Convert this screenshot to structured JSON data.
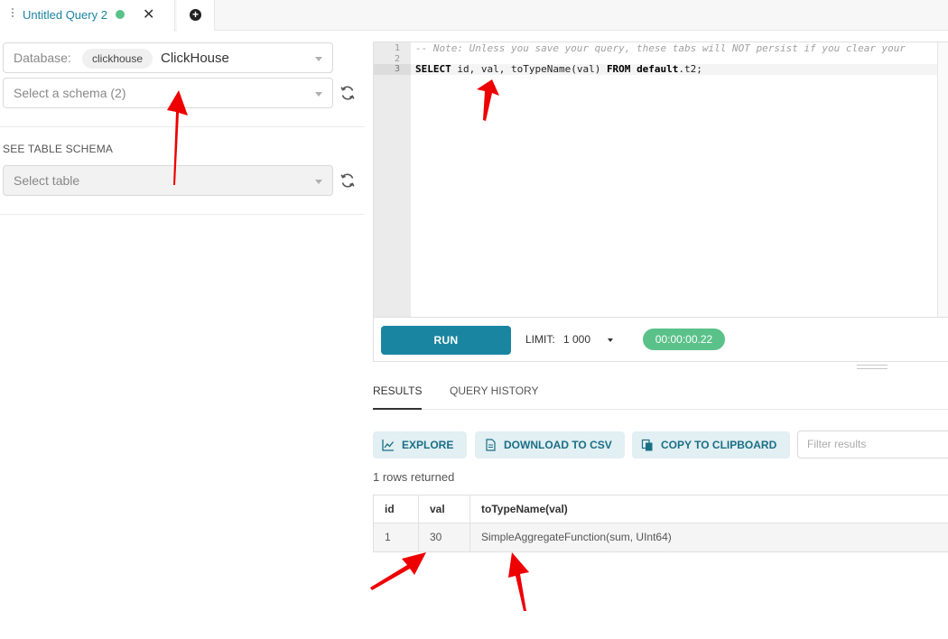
{
  "tab": {
    "title": "Untitled Query 2"
  },
  "database": {
    "label": "Database:",
    "chip": "clickhouse",
    "name": "ClickHouse"
  },
  "schema": {
    "placeholder": "Select a schema (2)"
  },
  "table_schema": {
    "section_label": "SEE TABLE SCHEMA",
    "placeholder": "Select table"
  },
  "editor": {
    "line_numbers": [
      "1",
      "2",
      "3"
    ],
    "comment": "-- Note: Unless you save your query, these tabs will NOT persist if you clear your",
    "sql": {
      "kw_select": "SELECT",
      "cols": " id, val, toTypeName(val) ",
      "kw_from": "FROM",
      "space": " ",
      "kw_default": "default",
      "rest": ".t2;"
    }
  },
  "toolbar": {
    "run_label": "RUN",
    "limit_label": "LIMIT:",
    "limit_value": "1 000",
    "timer": "00:00:00.22"
  },
  "results_tabs": {
    "results": "RESULTS",
    "history": "QUERY HISTORY"
  },
  "actions": {
    "explore": "EXPLORE",
    "download_csv": "DOWNLOAD TO CSV",
    "copy_clipboard": "COPY TO CLIPBOARD",
    "filter_placeholder": "Filter results"
  },
  "rows_returned": "1 rows returned",
  "table": {
    "headers": [
      "id",
      "val",
      "toTypeName(val)"
    ],
    "rows": [
      [
        "1",
        "30",
        "SimpleAggregateFunction(sum, UInt64)"
      ]
    ]
  },
  "colors": {
    "accent": "#1a85a0",
    "success": "#5ac189",
    "annotation": "#ee0000",
    "button_bg": "#e2eff3"
  }
}
